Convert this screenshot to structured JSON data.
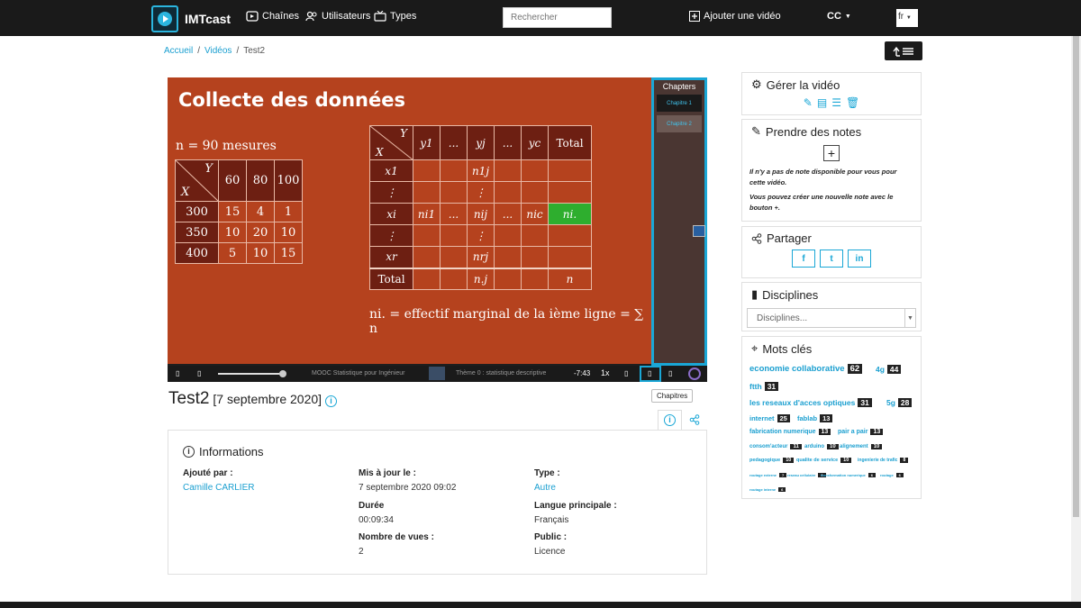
{
  "nav": {
    "brand": "IMTcast",
    "channels": "Chaînes",
    "users": "Utilisateurs",
    "types": "Types",
    "search_placeholder": "Rechercher",
    "add_video": "Ajouter une vidéo",
    "cc": "CC",
    "lang": "fr"
  },
  "breadcrumb": {
    "home": "Accueil",
    "videos": "Vidéos",
    "current": "Test2"
  },
  "slide": {
    "title": "Collecte des données",
    "n_measures": "n = 90 mesures",
    "small_table": {
      "corner_y": "Y",
      "corner_x": "X",
      "cols": [
        "60",
        "80",
        "100"
      ],
      "rows": [
        {
          "label": "300",
          "cells": [
            "15",
            "4",
            "1"
          ]
        },
        {
          "label": "350",
          "cells": [
            "10",
            "20",
            "10"
          ]
        },
        {
          "label": "400",
          "cells": [
            "5",
            "10",
            "15"
          ]
        }
      ]
    },
    "big_table": {
      "corner_y": "Y",
      "corner_x": "X",
      "cols": [
        "y1",
        "...",
        "yj",
        "...",
        "yc",
        "Total"
      ],
      "rows": [
        {
          "label": "x1",
          "cells": [
            "",
            "",
            "n1j",
            "",
            "",
            ""
          ]
        },
        {
          "label": "⋮",
          "cells": [
            "",
            "",
            "⋮",
            "",
            "",
            ""
          ]
        },
        {
          "label": "xi",
          "cells": [
            "ni1",
            "...",
            "nij",
            "...",
            "nic",
            "ni."
          ]
        },
        {
          "label": "⋮",
          "cells": [
            "",
            "",
            "⋮",
            "",
            "",
            ""
          ]
        },
        {
          "label": "xr",
          "cells": [
            "",
            "",
            "nrj",
            "",
            "",
            ""
          ]
        },
        {
          "label": "Total",
          "cells": [
            "",
            "",
            "n.j",
            "",
            "",
            "n"
          ]
        }
      ]
    },
    "formula": "ni. = effectif marginal de la ième ligne = ∑ n"
  },
  "chapters": {
    "title": "Chapters",
    "items": [
      "Chapitre 1",
      "Chapitre 2"
    ],
    "tooltip": "Chapitres"
  },
  "player": {
    "course_label": "MOOC Statistique pour Ingénieur",
    "theme_label": "Thème 0 : statistique descriptive",
    "time": "-7:43",
    "speed": "1x",
    "progress": 0.38
  },
  "video": {
    "title": "Test2",
    "date": "[7 septembre 2020]"
  },
  "info": {
    "header": "Informations",
    "added_by_label": "Ajouté par",
    "added_by": "Camille CARLIER",
    "updated_label": "Mis à jour le",
    "updated": "7 septembre 2020 09:02",
    "duration_label": "Durée",
    "duration": "00:09:34",
    "views_label": "Nombre de vues",
    "views": "2",
    "type_label": "Type",
    "type": "Autre",
    "language_label": "Langue principale",
    "language": "Français",
    "public_label": "Public",
    "public": "Licence"
  },
  "sidebar": {
    "manage_title": "Gérer la vidéo",
    "notes_title": "Prendre des notes",
    "notes_empty": "Il n'y a pas de note disponible pour vous pour cette vidéo.",
    "notes_hint": "Vous pouvez créer une nouvelle note avec le bouton +.",
    "share_title": "Partager",
    "disciplines_title": "Disciplines",
    "disciplines_placeholder": "Disciplines...",
    "keywords_title": "Mots clés"
  },
  "keywords": [
    {
      "label": "economie collaborative",
      "count": "62"
    },
    {
      "label": "4g",
      "count": "44"
    },
    {
      "label": "ftth",
      "count": "31"
    },
    {
      "label": "les reseaux d'acces optiques",
      "count": "31"
    },
    {
      "label": "5g",
      "count": "28"
    },
    {
      "label": "internet",
      "count": "25"
    },
    {
      "label": "fablab",
      "count": "13"
    },
    {
      "label": "fabrication numerique",
      "count": "13"
    },
    {
      "label": "pair a pair",
      "count": "13"
    },
    {
      "label": "consom'acteur",
      "count": "11"
    },
    {
      "label": "arduino",
      "count": "10"
    },
    {
      "label": "alignement",
      "count": "10"
    },
    {
      "label": "pedagogique",
      "count": "10"
    },
    {
      "label": "qualite de service",
      "count": "10"
    },
    {
      "label": "ingenierie de trafic",
      "count": "8"
    },
    {
      "label": "routage externe",
      "count": "7"
    },
    {
      "label": "reseau cellulaire",
      "count": "6"
    },
    {
      "label": "transformation numerique",
      "count": "6"
    },
    {
      "label": "routage",
      "count": "6"
    },
    {
      "label": "routage interne",
      "count": "6"
    }
  ]
}
